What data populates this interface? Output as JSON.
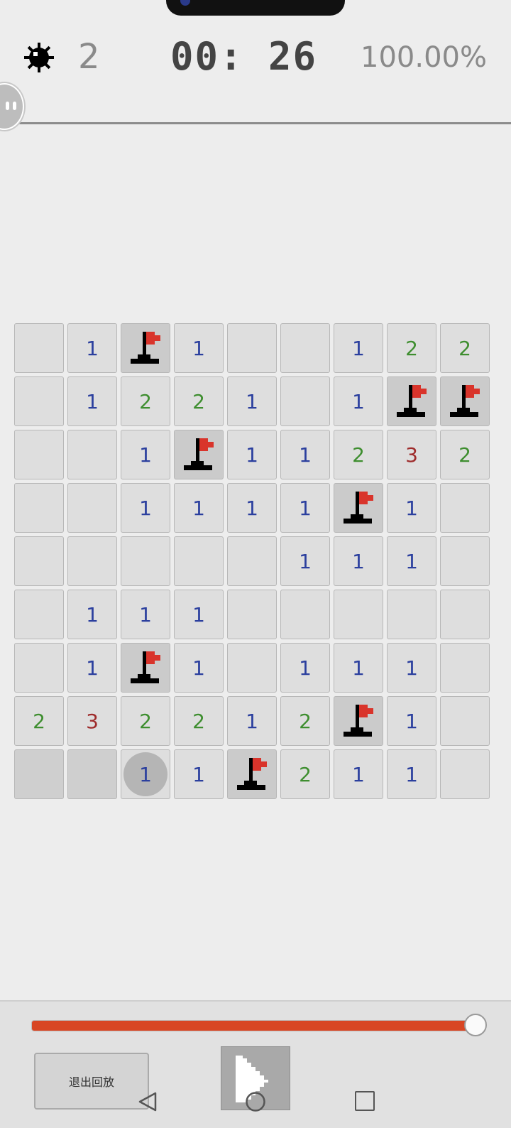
{
  "header": {
    "mines_remaining": "2",
    "timer": "00: 26",
    "progress_percent": "100.00%",
    "mine_icon": "mine-icon",
    "assist_icon": "assistant-bubble-icon"
  },
  "board": {
    "rows": 9,
    "cols": 9,
    "cells": [
      [
        "",
        "1",
        "F",
        "1",
        "",
        "",
        "1",
        "2",
        "2"
      ],
      [
        "",
        "1",
        "2",
        "2",
        "1",
        "",
        "1",
        "F",
        "F"
      ],
      [
        "",
        "",
        "1",
        "F",
        "1",
        "1",
        "2",
        "3",
        "2"
      ],
      [
        "",
        "",
        "1",
        "1",
        "1",
        "1",
        "F",
        "1",
        ""
      ],
      [
        "",
        "",
        "",
        "",
        "",
        "1",
        "1",
        "1",
        ""
      ],
      [
        "",
        "1",
        "1",
        "1",
        "",
        "",
        "",
        "",
        ""
      ],
      [
        "",
        "1",
        "F",
        "1",
        "",
        "1",
        "1",
        "1",
        ""
      ],
      [
        "2",
        "3",
        "2",
        "2",
        "1",
        "2",
        "F",
        "1",
        ""
      ],
      [
        "D",
        "D",
        "1",
        "1",
        "F",
        "2",
        "1",
        "1",
        ""
      ]
    ],
    "highlight": {
      "row": 8,
      "col": 2
    },
    "flag_icon": "flag-icon",
    "number_colors": {
      "1": "#2b3f9e",
      "2": "#3e8e2f",
      "3": "#9e2b2b"
    }
  },
  "replay": {
    "progress": 1.0,
    "exit_label": "退出回放",
    "play_icon": "play-icon",
    "accent_color": "#d84623"
  },
  "navbar": {
    "back_icon": "back-triangle-icon",
    "home_icon": "home-circle-icon",
    "recent_icon": "recents-square-icon"
  }
}
